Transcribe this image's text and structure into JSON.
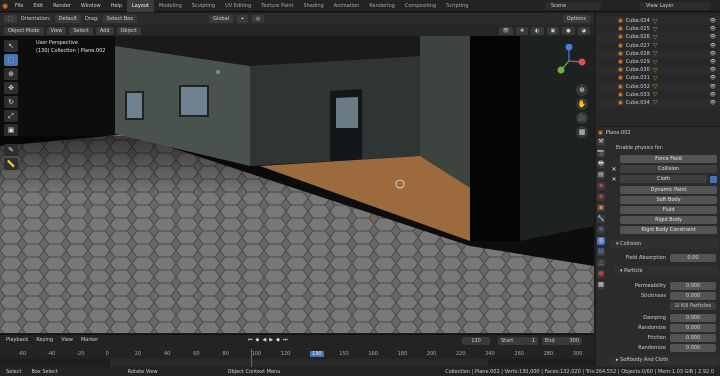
{
  "menubar": {
    "items": [
      "File",
      "Edit",
      "Render",
      "Window",
      "Help"
    ],
    "workspaces": [
      "Layout",
      "Modeling",
      "Sculpting",
      "UV Editing",
      "Texture Paint",
      "Shading",
      "Animation",
      "Rendering",
      "Compositing",
      "Scripting"
    ],
    "active_workspace": "Layout",
    "scene": "Scene",
    "view_layer": "View Layer"
  },
  "header": {
    "orientation_label": "Orientation:",
    "orientation_value": "Default",
    "drag_label": "Drag:",
    "drag_value": "Select Box",
    "transform": "Global",
    "options": "Options"
  },
  "viewport_header": {
    "mode": "Object Mode",
    "view": "View",
    "select": "Select",
    "add": "Add",
    "object": "Object"
  },
  "overlay": {
    "line1": "User Perspective",
    "line2": "(130) Collection | Plane.002"
  },
  "outliner": {
    "items": [
      "Cube.024",
      "Cube.025",
      "Cube.026",
      "Cube.027",
      "Cube.028",
      "Cube.029",
      "Cube.030",
      "Cube.031",
      "Cube.032",
      "Cube.033",
      "Cube.034"
    ]
  },
  "properties": {
    "object_name": "Plane.002",
    "enable_label": "Enable physics for:",
    "buttons": [
      "Force Field",
      "Collision",
      "Cloth",
      "Dynamic Paint",
      "Soft Body",
      "Fluid",
      "Rigid Body",
      "Rigid Body Constraint"
    ],
    "collision_header": "Collision",
    "field_absorption_label": "Field Absorption",
    "field_absorption": "0.00",
    "particle_header": "Particle",
    "permeability_label": "Permeability",
    "permeability": "0.000",
    "stickiness_label": "Stickiness",
    "stickiness": "0.000",
    "kill_particles": "Kill Particles",
    "damping_label": "Damping",
    "damping": "0.000",
    "randomize1_label": "Randomize",
    "randomize1": "0.000",
    "friction_label": "Friction",
    "friction": "0.000",
    "randomize2_label": "Randomize",
    "randomize2": "0.000",
    "softbody_header": "Softbody And Cloth"
  },
  "timeline": {
    "playback": "Playback",
    "keying": "Keying",
    "view": "View",
    "marker": "Marker",
    "current_frame": "130",
    "start_label": "Start",
    "start": "1",
    "end_label": "End",
    "end": "300",
    "ticks": [
      "-60",
      "-40",
      "-20",
      "0",
      "20",
      "40",
      "60",
      "80",
      "100",
      "120",
      "130",
      "150",
      "160",
      "180",
      "200",
      "220",
      "240",
      "260",
      "280",
      "300"
    ]
  },
  "statusbar": {
    "select": "Select",
    "box_select": "Box Select",
    "rotate": "Rotate View",
    "context": "Object Context Menu",
    "stats": "Collection | Plane.002 | Verts:130,000 | Faces:132,020 | Tris:264,552 | Objects:0/60 | Mem:1.03 GiB | 2.92.0"
  },
  "colors": {
    "accent": "#4772b3",
    "orange": "#e87d0d",
    "mesh": "#7cb342"
  }
}
